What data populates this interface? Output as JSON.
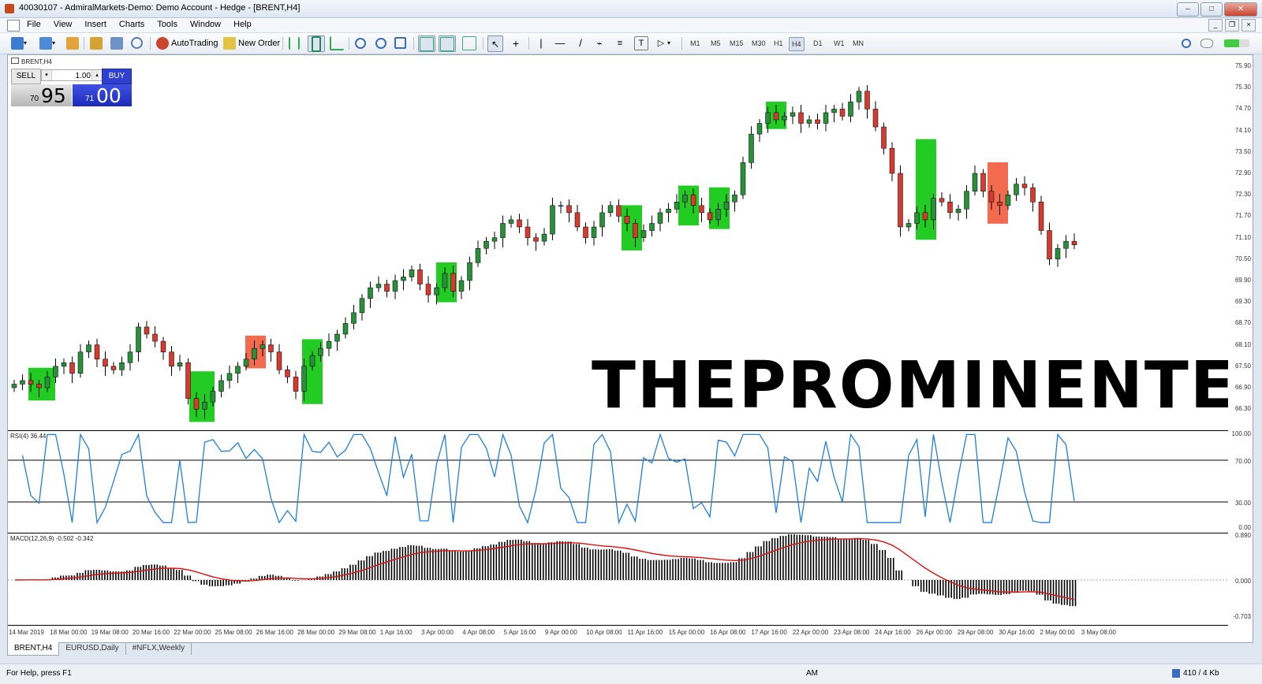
{
  "window": {
    "title": "40030107 - AdmiralMarkets-Demo: Demo Account - Hedge - [BRENT,H4]"
  },
  "menu": [
    "File",
    "View",
    "Insert",
    "Charts",
    "Tools",
    "Window",
    "Help"
  ],
  "toolbar": {
    "autotrading": "AutoTrading",
    "new_order": "New Order",
    "timeframes": [
      "M1",
      "M5",
      "M15",
      "M30",
      "H1",
      "H4",
      "D1",
      "W1",
      "MN"
    ],
    "active_timeframe": "H4"
  },
  "chart": {
    "label": "BRENT,H4",
    "trade": {
      "sell_label": "SELL",
      "buy_label": "BUY",
      "lot": "1.00",
      "bid_small": "70",
      "bid_big": "95",
      "ask_small": "71",
      "ask_big": "00"
    },
    "watermark": "THEPROMINENTE",
    "price_ticks": [
      "75.90",
      "75.30",
      "74.70",
      "74.10",
      "73.50",
      "72.90",
      "72.30",
      "71.70",
      "71.10",
      "70.50",
      "69.90",
      "69.30",
      "68.70",
      "68.10",
      "67.50",
      "66.90",
      "66.30"
    ],
    "time_ticks": [
      "14 Mar 2019",
      "18 Mar 00:00",
      "19 Mar 08:00",
      "20 Mar 16:00",
      "22 Mar 00:00",
      "25 Mar 08:00",
      "26 Mar 16:00",
      "28 Mar 00:00",
      "29 Mar 08:00",
      "1 Apr 16:00",
      "3 Apr 00:00",
      "4 Apr 08:00",
      "5 Apr 16:00",
      "9 Apr 00:00",
      "10 Apr 08:00",
      "11 Apr 16:00",
      "15 Apr 00:00",
      "16 Apr 08:00",
      "17 Apr 16:00",
      "22 Apr 00:00",
      "23 Apr 08:00",
      "24 Apr 16:00",
      "26 Apr 00:00",
      "29 Apr 08:00",
      "30 Apr 16:00",
      "2 May 00:00",
      "3 May 08:00"
    ]
  },
  "rsi": {
    "label": "RSI(4) 36.44",
    "ticks": [
      "100.00",
      "70.00",
      "30.00",
      "0.00"
    ]
  },
  "macd": {
    "label": "MACD(12,26,9) -0.502 -0.342",
    "ticks": [
      "0.890",
      "0.000",
      "-0.703"
    ]
  },
  "tabs": [
    "BRENT,H4",
    "EURUSD,Daily",
    "#NFLX,Weekly"
  ],
  "status": {
    "help": "For Help, press F1",
    "ampm": "AM",
    "traffic": "410 / 4 Kb"
  },
  "chart_data": [
    {
      "type": "candlestick",
      "title": "BRENT,H4",
      "ylim": [
        65.7,
        76.3
      ],
      "close_series": [
        67.0,
        67.1,
        67.0,
        66.9,
        67.2,
        67.5,
        67.6,
        67.3,
        67.9,
        68.1,
        67.7,
        67.5,
        67.4,
        67.6,
        67.9,
        68.6,
        68.4,
        68.2,
        67.9,
        67.5,
        67.6,
        66.6,
        66.3,
        66.5,
        66.8,
        67.1,
        67.3,
        67.5,
        67.7,
        68.0,
        68.1,
        67.9,
        67.4,
        67.2,
        66.8,
        67.5,
        67.8,
        68.0,
        68.2,
        68.4,
        68.7,
        69.0,
        69.4,
        69.7,
        69.8,
        69.6,
        69.9,
        70.0,
        70.2,
        69.8,
        69.5,
        69.7,
        70.1,
        69.6,
        69.9,
        70.4,
        70.8,
        71.0,
        71.1,
        71.5,
        71.6,
        71.4,
        71.1,
        71.0,
        71.2,
        72.0,
        72.0,
        71.8,
        71.4,
        71.1,
        71.4,
        71.8,
        72.0,
        71.7,
        71.5,
        71.1,
        71.3,
        71.5,
        71.8,
        71.9,
        72.1,
        72.3,
        72.0,
        71.8,
        71.6,
        71.9,
        72.1,
        72.3,
        73.2,
        74.0,
        74.3,
        74.6,
        74.4,
        74.5,
        74.6,
        74.3,
        74.4,
        74.3,
        74.6,
        74.7,
        74.5,
        74.9,
        75.2,
        74.7,
        74.2,
        73.6,
        72.9,
        71.4,
        71.5,
        71.8,
        71.6,
        72.2,
        72.1,
        71.8,
        71.9,
        72.4,
        72.9,
        72.4,
        72.1,
        72.0,
        72.3,
        72.6,
        72.5,
        72.1,
        71.3,
        70.5,
        70.8,
        71.0,
        70.9
      ]
    },
    {
      "type": "line",
      "title": "RSI(4) 36.44",
      "ylim": [
        0,
        100
      ]
    },
    {
      "type": "bar",
      "title": "MACD(12,26,9) -0.502 -0.342",
      "ylim": [
        -0.703,
        0.89
      ]
    }
  ]
}
